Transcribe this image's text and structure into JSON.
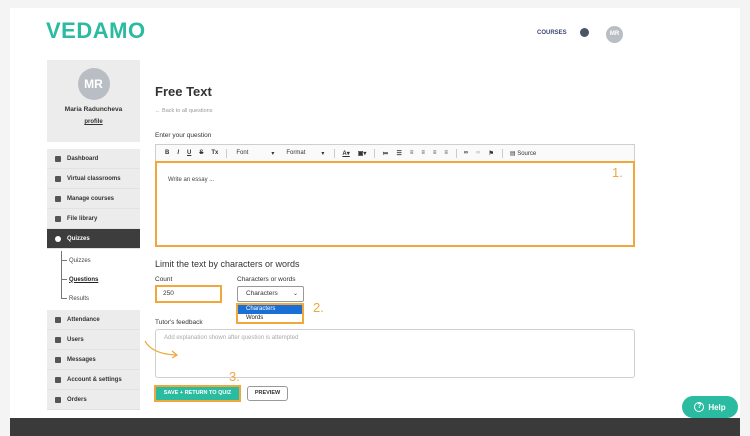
{
  "brand": {
    "logo": "VEDAMO",
    "accent": "#2bbba0",
    "highlight": "#f0a83c"
  },
  "topnav": {
    "courses": "COURSES",
    "globe_icon": "globe-icon",
    "avatar_initials": "MR"
  },
  "profile": {
    "initials": "MR",
    "name": "Maria Raduncheva",
    "link": "profile"
  },
  "sidebar": {
    "items": [
      {
        "label": "Dashboard",
        "icon": "grid-icon"
      },
      {
        "label": "Virtual classrooms",
        "icon": "gear-icon"
      },
      {
        "label": "Manage courses",
        "icon": "book-icon"
      },
      {
        "label": "File library",
        "icon": "cloud-icon"
      },
      {
        "label": "Quizzes",
        "icon": "question-icon"
      },
      {
        "label": "Attendance",
        "icon": "clipboard-icon"
      },
      {
        "label": "Users",
        "icon": "users-icon"
      },
      {
        "label": "Messages",
        "icon": "envelope-icon"
      },
      {
        "label": "Account & settings",
        "icon": "cog-icon"
      },
      {
        "label": "Orders",
        "icon": "cart-icon"
      }
    ],
    "subitems": [
      "Quizzes",
      "Questions",
      "Results"
    ]
  },
  "main": {
    "title": "Free Text",
    "back": "← Back to all questions",
    "question_label": "Enter your question",
    "toolbar": {
      "bold": "B",
      "italic": "I",
      "underline": "U",
      "strike": "S",
      "clear": "Tx",
      "font": "Font",
      "format": "Format",
      "source": "Source"
    },
    "editor_text": "Write an essay ...",
    "step1": "1.",
    "limit_title": "Limit the text by characters or words",
    "count_label": "Count",
    "count_value": "250",
    "type_label": "Characters or words",
    "select_value": "Characters",
    "options": [
      "Characters",
      "Words"
    ],
    "step2": "2.",
    "feedback_label": "Tutor's feedback",
    "feedback_placeholder": "Add explanation shown after question is attempted",
    "step3": "3.",
    "save_button": "SAVE + RETURN TO QUIZ",
    "preview_button": "PREVIEW"
  },
  "help": {
    "label": "Help"
  }
}
